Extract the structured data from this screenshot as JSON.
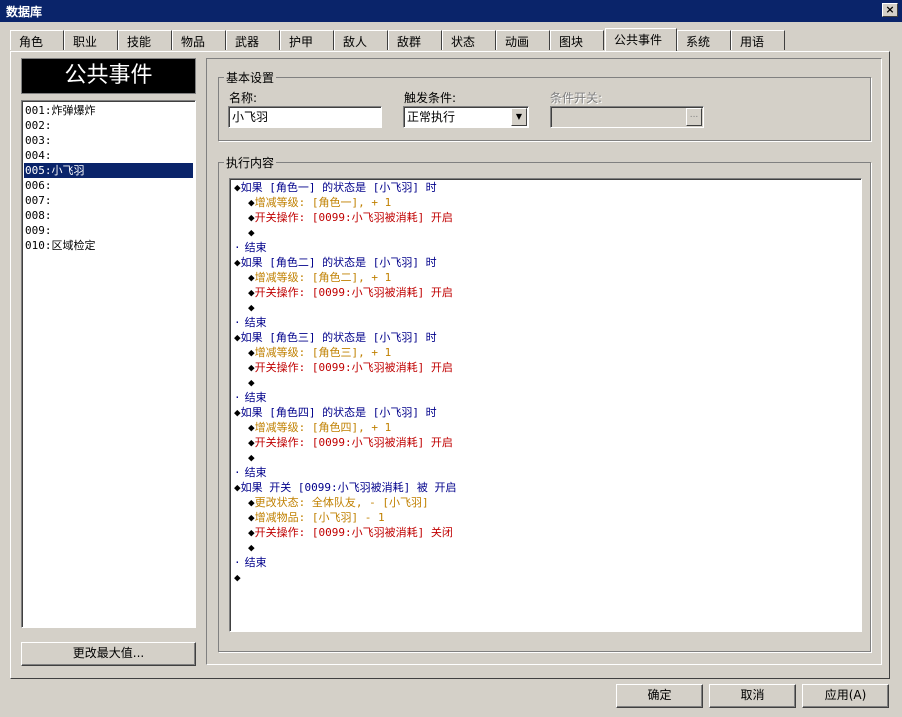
{
  "window": {
    "title": "数据库",
    "close_glyph": "×"
  },
  "tabs": [
    {
      "label": "角色"
    },
    {
      "label": "职业"
    },
    {
      "label": "技能"
    },
    {
      "label": "物品"
    },
    {
      "label": "武器"
    },
    {
      "label": "护甲"
    },
    {
      "label": "敌人"
    },
    {
      "label": "敌群"
    },
    {
      "label": "状态"
    },
    {
      "label": "动画"
    },
    {
      "label": "图块"
    },
    {
      "label": "公共事件"
    },
    {
      "label": "系统"
    },
    {
      "label": "用语"
    }
  ],
  "active_tab": "公共事件",
  "left": {
    "title": "公共事件",
    "items": [
      {
        "label": "001:炸弹爆炸"
      },
      {
        "label": "002:"
      },
      {
        "label": "003:"
      },
      {
        "label": "004:"
      },
      {
        "label": "005:小飞羽"
      },
      {
        "label": "006:"
      },
      {
        "label": "007:"
      },
      {
        "label": "008:"
      },
      {
        "label": "009:"
      },
      {
        "label": "010:区域检定"
      }
    ],
    "selected_index": 4,
    "change_max_label": "更改最大值..."
  },
  "basic": {
    "group_label": "基本设置",
    "name_label": "名称:",
    "name_value": "小飞羽",
    "trigger_label": "触发条件:",
    "trigger_value": "正常执行",
    "switch_label": "条件开关:",
    "switch_value": "",
    "switch_button": "..."
  },
  "content": {
    "group_label": "执行内容",
    "commands": [
      {
        "mark": "◆",
        "text": "如果 [角色一] 的状态是 [小飞羽] 时",
        "color": "#00008b",
        "indent": 0
      },
      {
        "mark": "◆",
        "text": "增减等级: [角色一], + 1",
        "color": "#c08000",
        "indent": 1
      },
      {
        "mark": "◆",
        "text": "开关操作: [0099:小飞羽被消耗] 开启",
        "color": "#c00000",
        "indent": 1
      },
      {
        "mark": "◆",
        "text": "",
        "color": "#000000",
        "indent": 1
      },
      {
        "mark": "·",
        "text": "结束",
        "color": "#00008b",
        "indent": 0
      },
      {
        "mark": "◆",
        "text": "如果 [角色二] 的状态是 [小飞羽] 时",
        "color": "#00008b",
        "indent": 0
      },
      {
        "mark": "◆",
        "text": "增减等级: [角色二], + 1",
        "color": "#c08000",
        "indent": 1
      },
      {
        "mark": "◆",
        "text": "开关操作: [0099:小飞羽被消耗] 开启",
        "color": "#c00000",
        "indent": 1
      },
      {
        "mark": "◆",
        "text": "",
        "color": "#000000",
        "indent": 1
      },
      {
        "mark": "·",
        "text": "结束",
        "color": "#00008b",
        "indent": 0
      },
      {
        "mark": "◆",
        "text": "如果 [角色三] 的状态是 [小飞羽] 时",
        "color": "#00008b",
        "indent": 0
      },
      {
        "mark": "◆",
        "text": "增减等级: [角色三], + 1",
        "color": "#c08000",
        "indent": 1
      },
      {
        "mark": "◆",
        "text": "开关操作: [0099:小飞羽被消耗] 开启",
        "color": "#c00000",
        "indent": 1
      },
      {
        "mark": "◆",
        "text": "",
        "color": "#000000",
        "indent": 1
      },
      {
        "mark": "·",
        "text": "结束",
        "color": "#00008b",
        "indent": 0
      },
      {
        "mark": "◆",
        "text": "如果 [角色四] 的状态是 [小飞羽] 时",
        "color": "#00008b",
        "indent": 0
      },
      {
        "mark": "◆",
        "text": "增减等级: [角色四], + 1",
        "color": "#c08000",
        "indent": 1
      },
      {
        "mark": "◆",
        "text": "开关操作: [0099:小飞羽被消耗] 开启",
        "color": "#c00000",
        "indent": 1
      },
      {
        "mark": "◆",
        "text": "",
        "color": "#000000",
        "indent": 1
      },
      {
        "mark": "·",
        "text": "结束",
        "color": "#00008b",
        "indent": 0
      },
      {
        "mark": "◆",
        "text": "如果 开关 [0099:小飞羽被消耗] 被 开启",
        "color": "#00008b",
        "indent": 0
      },
      {
        "mark": "◆",
        "text": "更改状态: 全体队友, - [小飞羽]",
        "color": "#c08000",
        "indent": 1
      },
      {
        "mark": "◆",
        "text": "增减物品: [小飞羽] - 1",
        "color": "#c08000",
        "indent": 1
      },
      {
        "mark": "◆",
        "text": "开关操作: [0099:小飞羽被消耗] 关闭",
        "color": "#c00000",
        "indent": 1
      },
      {
        "mark": "◆",
        "text": "",
        "color": "#000000",
        "indent": 1
      },
      {
        "mark": "·",
        "text": "结束",
        "color": "#00008b",
        "indent": 0
      },
      {
        "mark": "◆",
        "text": "",
        "color": "#000000",
        "indent": 0
      }
    ]
  },
  "footer": {
    "ok_label": "确定",
    "cancel_label": "取消",
    "apply_label": "应用(A)"
  }
}
